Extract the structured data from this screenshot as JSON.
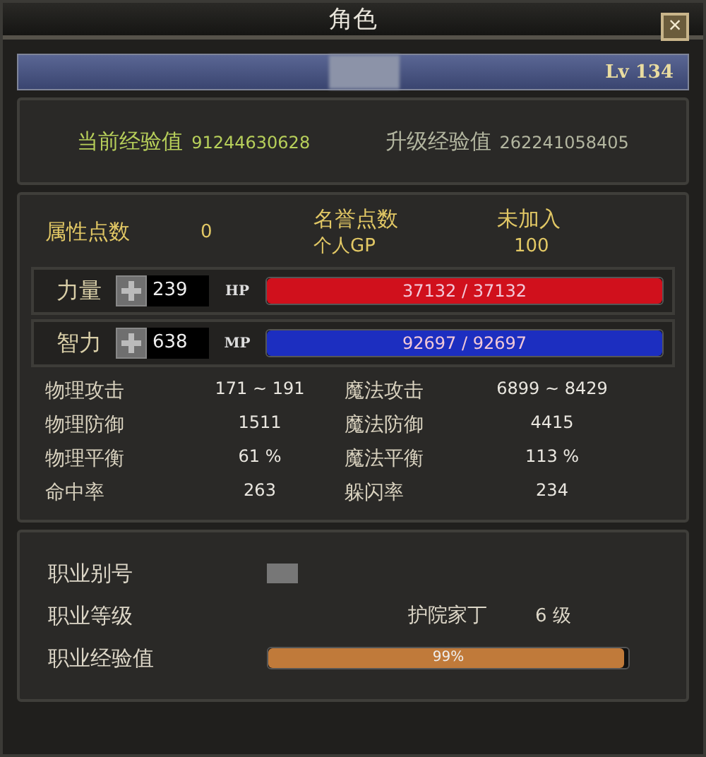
{
  "window": {
    "title": "角色",
    "close": "×"
  },
  "header": {
    "level": "Lv 134"
  },
  "experience": {
    "current_label": "当前经验值",
    "current": "91244630628",
    "next_label": "升级经验值",
    "next": "262241058405"
  },
  "points": {
    "attr_label": "属性点数",
    "attr": "0",
    "honor_label": "名誉点数",
    "honor": "未加入",
    "gp_label": "个人GP",
    "gp": "100"
  },
  "resources": [
    {
      "stat": "力量",
      "value": "239",
      "bar_label": "HP",
      "reading": "37132 / 37132",
      "level": 1,
      "color": "#d0101c"
    },
    {
      "stat": "智力",
      "value": "638",
      "bar_label": "MP",
      "reading": "92697 / 92697",
      "level": 1,
      "color": "#1c2ec0"
    }
  ],
  "stats": [
    {
      "label": "物理攻击",
      "value": "171 ~ 191"
    },
    {
      "label": "魔法攻击",
      "value": "6899 ~ 8429"
    },
    {
      "label": "物理防御",
      "value": "1511"
    },
    {
      "label": "魔法防御",
      "value": "4415"
    },
    {
      "label": "物理平衡",
      "value": "61 %"
    },
    {
      "label": "魔法平衡",
      "value": "113 %"
    },
    {
      "label": "命中率",
      "value": "263"
    },
    {
      "label": "躲闪率",
      "value": "234"
    }
  ],
  "job": {
    "alias_label": "职业别号",
    "rank_label": "职业等级",
    "rank_name": "护院家丁",
    "rank_level": "6 级",
    "exp_label": "职业经验值",
    "exp_reading": "99%",
    "level": 0.99
  }
}
